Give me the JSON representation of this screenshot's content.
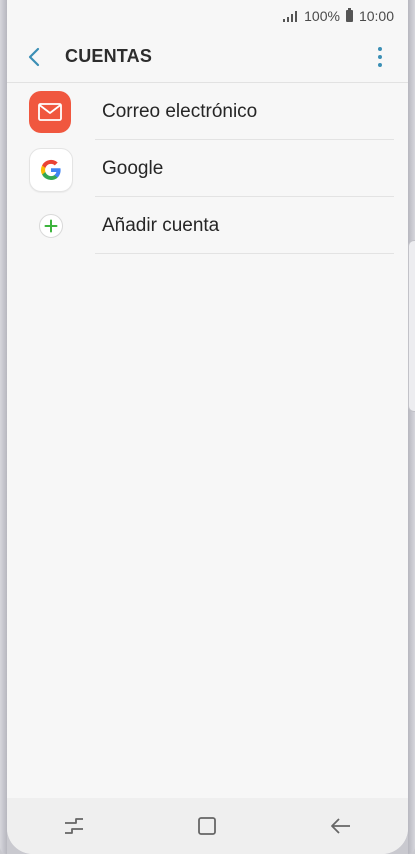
{
  "status_bar": {
    "battery_percent": "100%",
    "time": "10:00"
  },
  "header": {
    "title": "CUENTAS"
  },
  "accounts": [
    {
      "label": "Correo electrónico",
      "icon": "mail-icon"
    },
    {
      "label": "Google",
      "icon": "google-icon"
    },
    {
      "label": "Añadir cuenta",
      "icon": "add-icon"
    }
  ],
  "colors": {
    "accent": "#3b8fb5",
    "mail": "#f0573f",
    "add": "#3cb43c"
  },
  "navigation": {
    "buttons": [
      "recent-apps-icon",
      "home-icon",
      "back-icon"
    ]
  }
}
